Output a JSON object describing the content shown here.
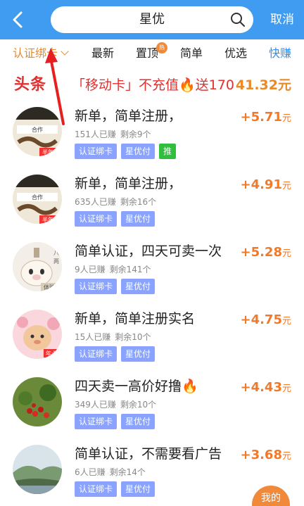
{
  "header": {
    "search_value": "星优",
    "cancel_label": "取消"
  },
  "tabs": [
    {
      "label": "认证绑卡",
      "state": "active"
    },
    {
      "label": "最新"
    },
    {
      "label": "置顶",
      "badge": "热"
    },
    {
      "label": "简单"
    },
    {
      "label": "优选"
    },
    {
      "label": "快赚",
      "state": "blue"
    }
  ],
  "headline": {
    "logo_text": "头条",
    "text": "「移动卡」不充值🔥送170",
    "amount": "41.32元"
  },
  "tasks": [
    {
      "title": "新单，简单注册，",
      "earned": "151人已赚",
      "remaining": "剩余9个",
      "tags": [
        "认证绑卡",
        "星优付",
        "推"
      ],
      "amount": "+5.71",
      "unit": "元",
      "avatar": "handshake-avatar",
      "avatar_text": "半年"
    },
    {
      "title": "新单，简单注册，",
      "earned": "635人已赚",
      "remaining": "剩余16个",
      "tags": [
        "认证绑卡",
        "星优付"
      ],
      "amount": "+4.91",
      "unit": "元",
      "avatar": "handshake-avatar",
      "avatar_text": "半年"
    },
    {
      "title": "简单认证，四天可卖一次",
      "earned": "9人已赚",
      "remaining": "剩余141个",
      "tags": [
        "认证绑卡",
        "星优付"
      ],
      "amount": "+5.28",
      "unit": "元",
      "avatar": "pig-avatar",
      "avatar_text": "体验"
    },
    {
      "title": "新单，简单注册实名",
      "earned": "15人已赚",
      "remaining": "剩余10个",
      "tags": [
        "认证绑卡",
        "星优付"
      ],
      "amount": "+4.75",
      "unit": "元",
      "avatar": "bear-avatar",
      "avatar_text": "年卡"
    },
    {
      "title": "四天卖一高价好撸🔥",
      "earned": "349人已赚",
      "remaining": "剩余10个",
      "tags": [
        "认证绑卡",
        "星优付"
      ],
      "amount": "+4.43",
      "unit": "元",
      "avatar": "cherry-avatar"
    },
    {
      "title": "简单认证，不需要看广告",
      "earned": "6人已赚",
      "remaining": "剩余14个",
      "tags": [
        "认证绑卡",
        "星优付"
      ],
      "amount": "+3.68",
      "unit": "元",
      "avatar": "landscape-avatar"
    }
  ],
  "floating": {
    "label": "我的"
  },
  "colors": {
    "header": "#3f9cf0",
    "accent": "#e88a2a",
    "headline": "#e03030",
    "tag": "#8aa3ff",
    "tag_green": "#2fbf3c"
  }
}
